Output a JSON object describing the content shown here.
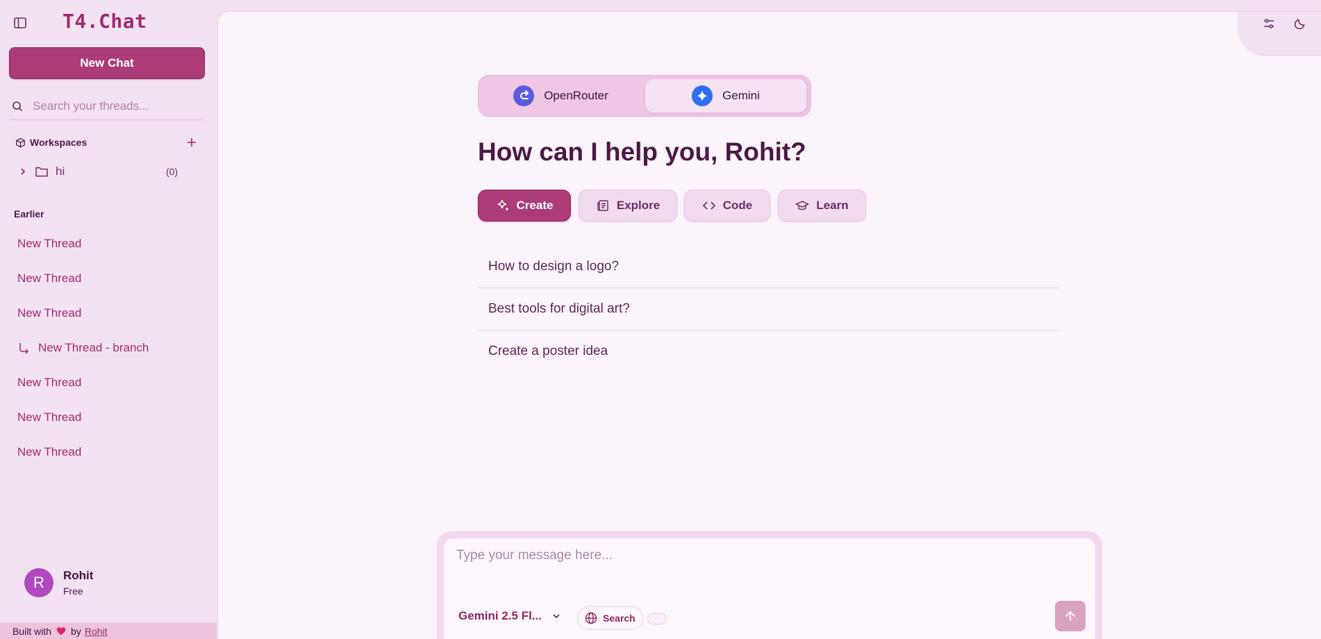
{
  "sidebar": {
    "brand": "T4.Chat",
    "new_chat_label": "New Chat",
    "search_placeholder": "Search your threads...",
    "workspaces": {
      "title": "Workspaces",
      "items": [
        {
          "name": "hi",
          "count": "(0)"
        }
      ]
    },
    "section_label": "Earlier",
    "threads": [
      {
        "label": "New Thread",
        "branch": false
      },
      {
        "label": "New Thread",
        "branch": false
      },
      {
        "label": "New Thread",
        "branch": false
      },
      {
        "label": "New Thread - branch",
        "branch": true
      },
      {
        "label": "New Thread",
        "branch": false
      },
      {
        "label": "New Thread",
        "branch": false
      },
      {
        "label": "New Thread",
        "branch": false
      }
    ],
    "user": {
      "initial": "R",
      "name": "Rohit",
      "plan": "Free"
    },
    "footer": {
      "prefix": "Built with",
      "by": "by",
      "author": "Rohit"
    }
  },
  "main": {
    "providers": [
      {
        "label": "OpenRouter",
        "active": false
      },
      {
        "label": "Gemini",
        "active": true
      }
    ],
    "greeting": "How can I help you, Rohit?",
    "categories": [
      {
        "label": "Create",
        "icon": "sparkles-icon",
        "active": true
      },
      {
        "label": "Explore",
        "icon": "newspaper-icon",
        "active": false
      },
      {
        "label": "Code",
        "icon": "code-icon",
        "active": false
      },
      {
        "label": "Learn",
        "icon": "graduation-cap-icon",
        "active": false
      }
    ],
    "suggestions": [
      "How to design a logo?",
      "Best tools for digital art?",
      "Create a poster idea"
    ]
  },
  "composer": {
    "placeholder": "Type your message here...",
    "model": "Gemini 2.5 Fl...",
    "search_label": "Search"
  },
  "colors": {
    "accent": "#ab3c77",
    "sidebar_bg": "#f3e2f2",
    "main_bg": "#fcf4fc",
    "text_dark": "#4a1a45"
  }
}
